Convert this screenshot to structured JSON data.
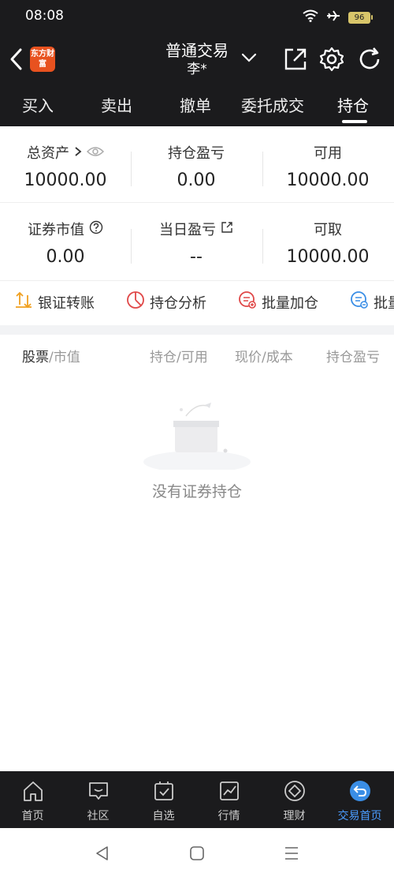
{
  "status": {
    "time": "08:08",
    "battery": "96"
  },
  "header": {
    "logo": "东方财富",
    "title": "普通交易",
    "account": "李*"
  },
  "tabs": [
    {
      "label": "买入"
    },
    {
      "label": "卖出"
    },
    {
      "label": "撤单"
    },
    {
      "label": "委托成交"
    },
    {
      "label": "持仓"
    }
  ],
  "stats": {
    "total_assets": {
      "label": "总资产",
      "value": "10000.00"
    },
    "position_pnl": {
      "label": "持仓盈亏",
      "value": "0.00"
    },
    "available": {
      "label": "可用",
      "value": "10000.00"
    },
    "market_value": {
      "label": "证券市值",
      "value": "0.00"
    },
    "daily_pnl": {
      "label": "当日盈亏",
      "value": "--"
    },
    "withdrawable": {
      "label": "可取",
      "value": "10000.00"
    }
  },
  "actions": [
    {
      "label": "银证转账"
    },
    {
      "label": "持仓分析"
    },
    {
      "label": "批量加仓"
    },
    {
      "label": "批量"
    }
  ],
  "table": {
    "col_stock": "股票",
    "col_stock_sub": "/市值",
    "col_position": "持仓/可用",
    "col_price": "现价/成本",
    "col_pnl": "持仓盈亏"
  },
  "empty_text": "没有证券持仓",
  "bottom_nav": [
    {
      "label": "首页"
    },
    {
      "label": "社区"
    },
    {
      "label": "自选"
    },
    {
      "label": "行情"
    },
    {
      "label": "理财"
    },
    {
      "label": "交易首页"
    }
  ],
  "colors": {
    "accent": "#4a9cff",
    "brand": "#e8521f",
    "dark": "#1b1b1d"
  }
}
